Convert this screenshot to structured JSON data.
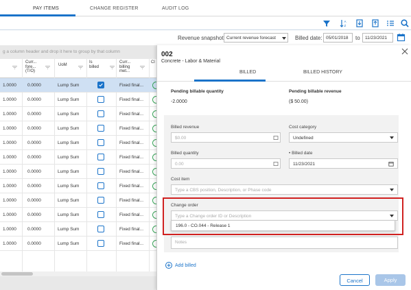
{
  "tabs": [
    {
      "label": "PAY ITEMS",
      "active": true
    },
    {
      "label": "CHANGE REGISTER",
      "active": false
    },
    {
      "label": "AUDIT LOG",
      "active": false
    }
  ],
  "toolbar": {
    "icons": [
      "filter-icon",
      "sort-icon",
      "export-icon",
      "import-icon",
      "column-settings-icon",
      "search-icon"
    ]
  },
  "snapshot": {
    "label": "Revenue snapshot:",
    "value": "Current revenue forecast",
    "billed_date_label": "Billed date:",
    "date_from": "05/01/2018",
    "to_label": "to",
    "date_to": "11/23/2021"
  },
  "grid": {
    "group_hint": "g a column header and drop it here to group by that column",
    "columns": [
      "Curr... fore... (T/O)",
      "UoM",
      "Is billed",
      "Curr... billing met...",
      "Cl"
    ],
    "rows": [
      {
        "qty": "1.0000",
        "fore": "0.0000",
        "uom": "Lump Sum",
        "billed": true,
        "method": "Fixed final...",
        "selected": true
      },
      {
        "qty": "1.0000",
        "fore": "0.0000",
        "uom": "Lump Sum",
        "billed": false,
        "method": "Fixed final...",
        "selected": false
      },
      {
        "qty": "1.0000",
        "fore": "0.0000",
        "uom": "Lump Sum",
        "billed": false,
        "method": "Fixed final...",
        "selected": false
      },
      {
        "qty": "1.0000",
        "fore": "0.0000",
        "uom": "Lump Sum",
        "billed": false,
        "method": "Fixed final...",
        "selected": false
      },
      {
        "qty": "1.0000",
        "fore": "0.0000",
        "uom": "Lump Sum",
        "billed": false,
        "method": "Fixed final...",
        "selected": false
      },
      {
        "qty": "1.0000",
        "fore": "0.0000",
        "uom": "Lump Sum",
        "billed": false,
        "method": "Fixed final...",
        "selected": false
      },
      {
        "qty": "1.0000",
        "fore": "0.0000",
        "uom": "Lump Sum",
        "billed": false,
        "method": "Fixed final...",
        "selected": false
      },
      {
        "qty": "1.0000",
        "fore": "0.0000",
        "uom": "Lump Sum",
        "billed": false,
        "method": "Fixed final...",
        "selected": false
      },
      {
        "qty": "1.0000",
        "fore": "0.0000",
        "uom": "Lump Sum",
        "billed": false,
        "method": "Fixed final...",
        "selected": false
      },
      {
        "qty": "1.0000",
        "fore": "0.0000",
        "uom": "Lump Sum",
        "billed": false,
        "method": "Fixed final...",
        "selected": false
      },
      {
        "qty": "1.0000",
        "fore": "0.0000",
        "uom": "Lump Sum",
        "billed": false,
        "method": "Fixed final...",
        "selected": false
      },
      {
        "qty": "1.0000",
        "fore": "0.0000",
        "uom": "Lump Sum",
        "billed": false,
        "method": "Fixed final...",
        "selected": false
      }
    ]
  },
  "panel": {
    "title": "002",
    "subtitle": "Concrete - Labor & Material",
    "tabs": [
      "BILLED",
      "BILLED HISTORY"
    ],
    "pending_qty_label": "Pending billable quantity",
    "pending_qty_value": "-2.0000",
    "pending_rev_label": "Pending billable revenue",
    "pending_rev_value": "($ 50.00)",
    "billed_revenue_label": "Billed revenue",
    "billed_revenue_placeholder": "$0.00",
    "cost_category_label": "Cost category",
    "cost_category_value": "Undefined",
    "billed_qty_label": "Billed quantity",
    "billed_qty_placeholder": "0.00",
    "billed_date_label": "• Billed date",
    "billed_date_value": "11/23/2021",
    "cost_item_label": "Cost item",
    "cost_item_placeholder": "Type a CBS position, Description, or Phase code",
    "change_order_label": "Change order",
    "change_order_placeholder": "Type a Change order ID or Description",
    "change_order_option": "196.0 - CO.044 - Release 1",
    "notes_placeholder": "Notes",
    "add_billed": "Add billed",
    "cancel": "Cancel",
    "apply": "Apply"
  },
  "colors": {
    "accent": "#1a73c9",
    "highlight": "#d0201f",
    "selected_row": "#cfe0f3"
  }
}
